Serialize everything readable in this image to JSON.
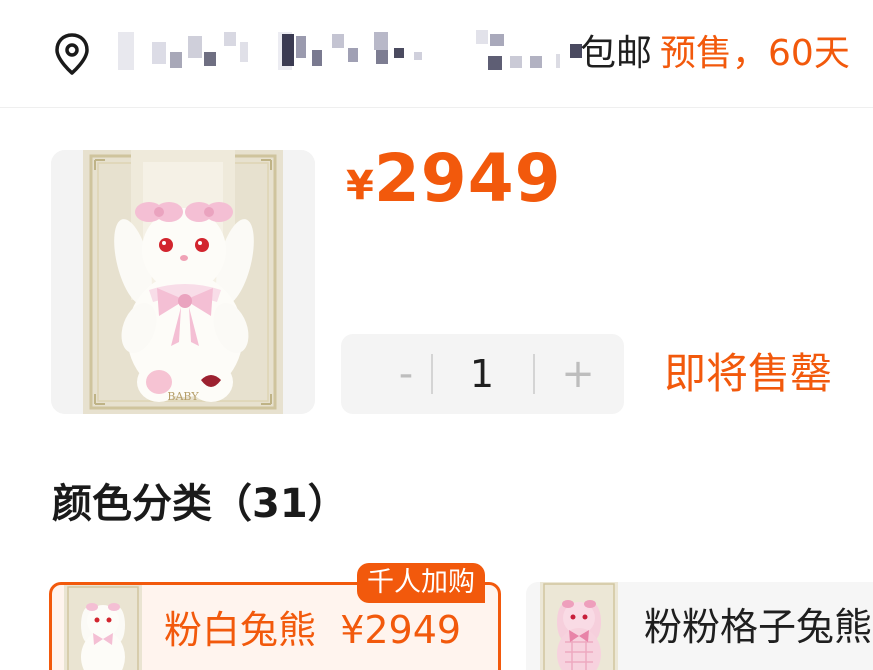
{
  "shipping": {
    "icon": "location-pin-icon",
    "free_shipping": "包邮",
    "presale": "预售，60天"
  },
  "product": {
    "currency": "¥",
    "price": "2949",
    "quantity": "1",
    "minus_label": "-",
    "plus_label": "+",
    "status": "即将售罄"
  },
  "color_section": {
    "title": "颜色分类（31）"
  },
  "variants": [
    {
      "label": "粉白兔熊",
      "price": "¥2949",
      "badge": "千人加购",
      "selected": true
    },
    {
      "label": "粉粉格子兔熊",
      "selected": false
    }
  ],
  "colors": {
    "accent": "#f2590c",
    "stepper_bg": "#f4f4f4",
    "selected_bg": "#fff4ee"
  }
}
